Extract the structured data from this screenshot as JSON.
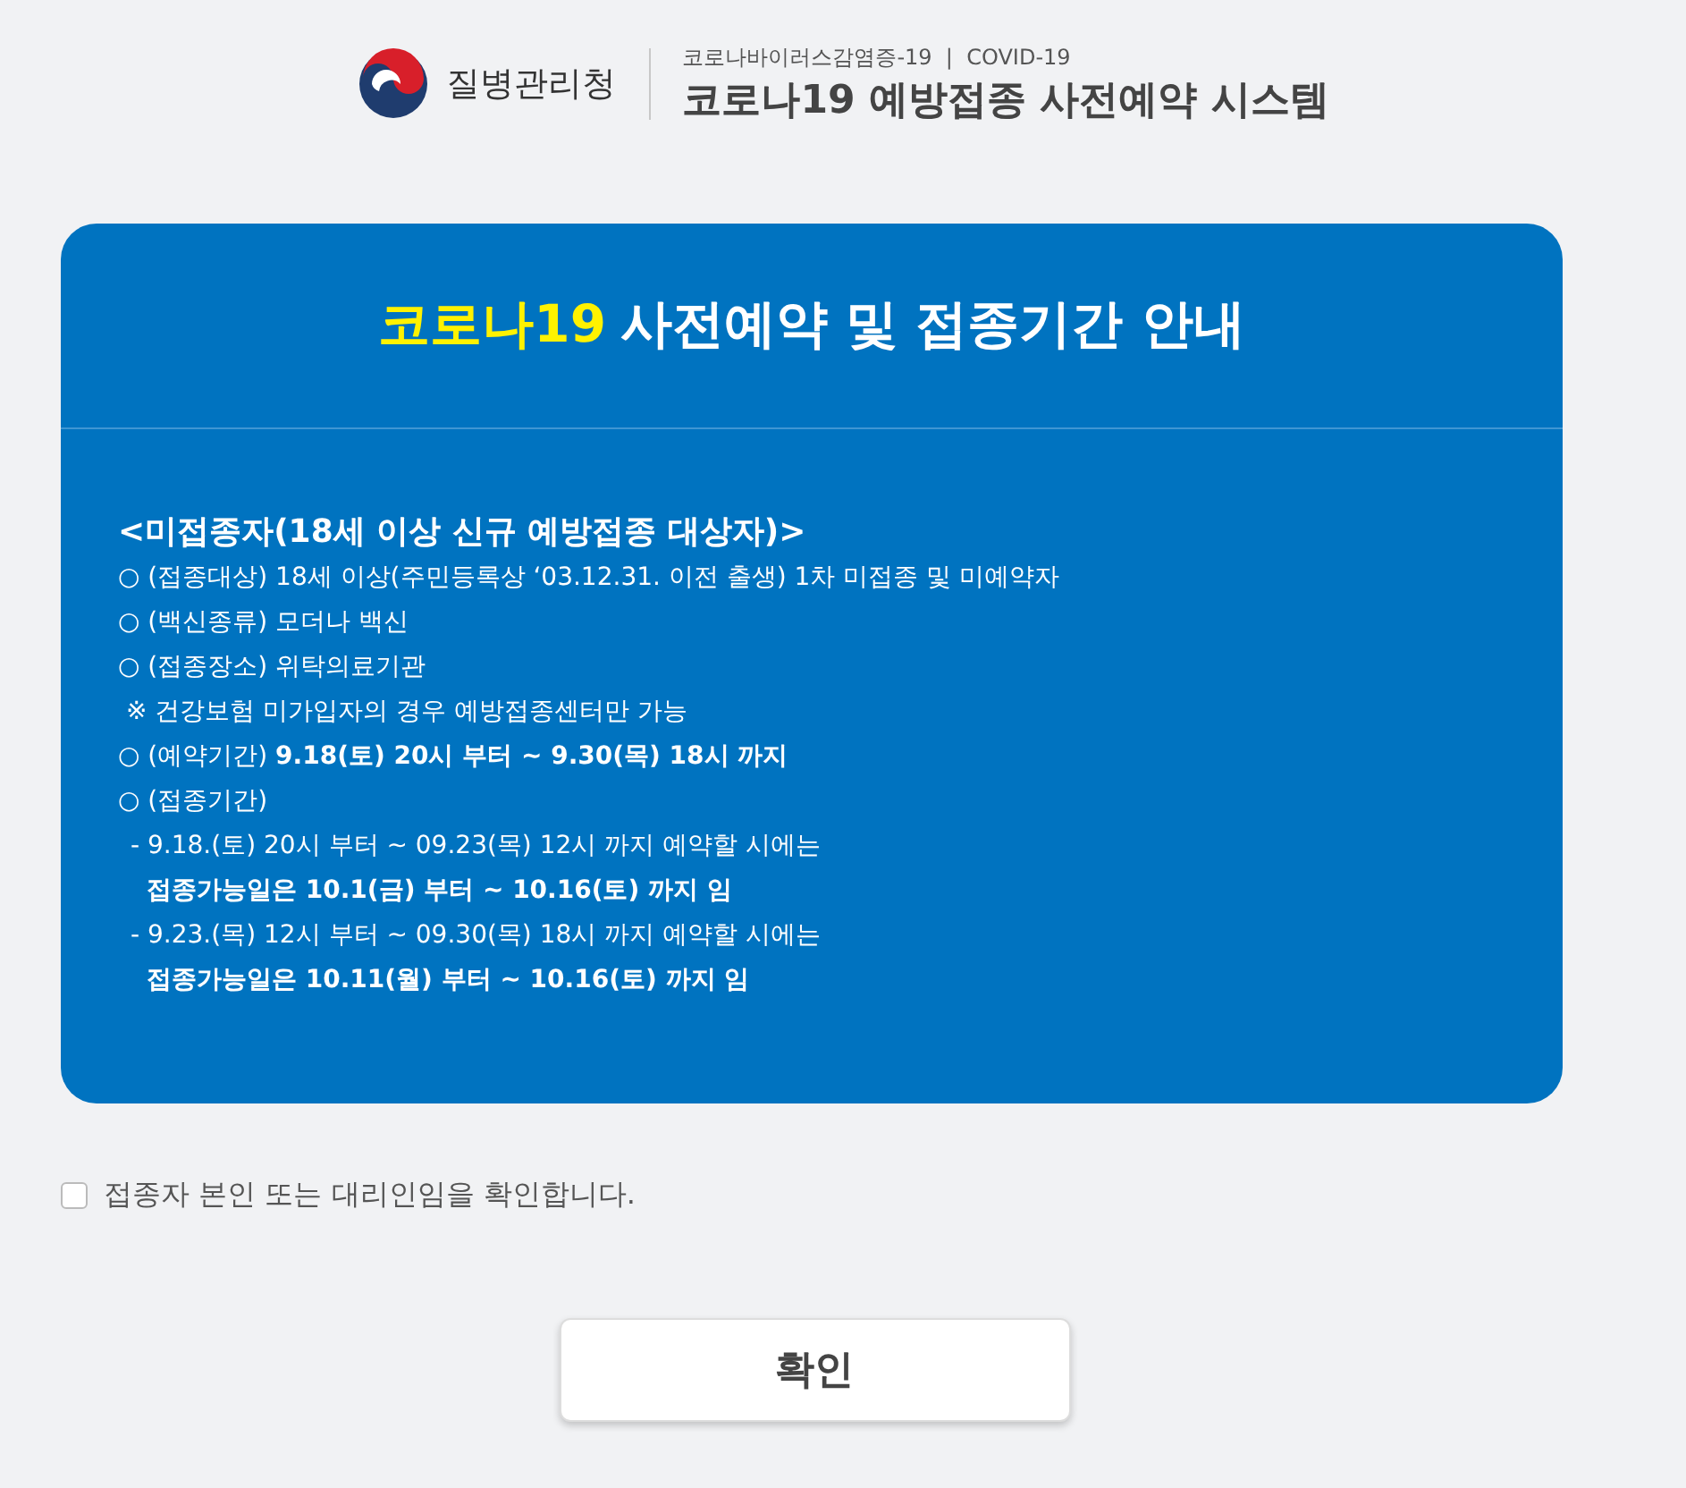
{
  "header": {
    "agency": "질병관리청",
    "subtitle": "코로나바이러스감염증-19  |  COVID-19",
    "title": "코로나19 예방접종 사전예약 시스템"
  },
  "notice": {
    "title_highlight": "코로나19",
    "title_rest": "사전예약 및 접종기간 안내",
    "heading": "<미접종자(18세 이상 신규 예방접종 대상자)>",
    "lines": [
      {
        "text": "○ (접종대상) 18세 이상(주민등록상 ‘03.12.31. 이전 출생) 1차 미접종 및 미예약자"
      },
      {
        "text": "○ (백신종류) 모더나 백신"
      },
      {
        "text": "○ (접종장소) 위탁의료기관"
      },
      {
        "text": " ※ 건강보험 미가입자의 경우 예방접종센터만 가능"
      },
      {
        "text": "○ (예약기간) **9.18(토) 20시 부터 ~ 9.30(목) 18시 까지**"
      },
      {
        "text": "○ (접종기간)",
        "children": [
          {
            "text": "- 9.18.(토) 20시 부터 ~ 09.23(목) 12시 까지 예약할 시에는",
            "children": [
              {
                "text": "**접종가능일은 10.1(금) 부터 ~ 10.16(토) 까지 임**"
              }
            ]
          },
          {
            "text": "- 9.23.(목) 12시 부터 ~ 09.30(목) 18시 까지 예약할 시에는",
            "children": [
              {
                "text": "**접종가능일은 10.11(월) 부터 ~ 10.16(토) 까지 임**"
              }
            ]
          }
        ]
      }
    ]
  },
  "consent": {
    "label": "접종자 본인 또는 대리인임을 확인합니다.",
    "checked": false
  },
  "button": "확인"
}
